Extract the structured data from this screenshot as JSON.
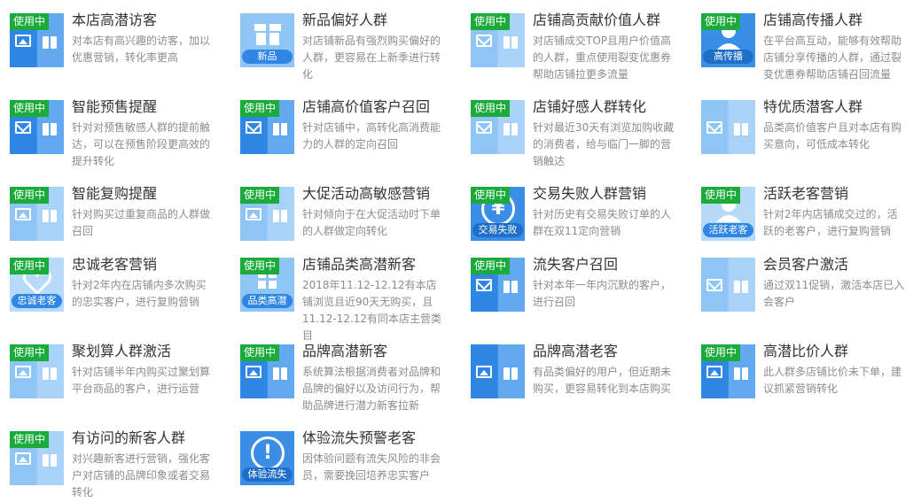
{
  "badge_text": "使用中",
  "cards": [
    {
      "title": "本店高潜访客",
      "desc": "对本店有高兴趣的访客，加以优惠营销，转化率更高"
    },
    {
      "title": "新品偏好人群",
      "desc": "对店铺新品有强烈购买偏好的人群，更容易在上新季进行转化",
      "icon_label": "新品"
    },
    {
      "title": "店铺高贡献价值人群",
      "desc": "对店铺成交TOP且用户价值高的人群，重点使用裂变优惠券帮助店铺拉更多流量"
    },
    {
      "title": "店铺高传播人群",
      "desc": "在平台高互动，能够有效帮助店铺分享传播的人群，通过裂变优惠券帮助店铺召回流量",
      "icon_label": "高传播"
    },
    {
      "title": "智能预售提醒",
      "desc": "针对对预售敏感人群的提前触达，可以在预售阶段更高效的提升转化"
    },
    {
      "title": "店铺高价值客户召回",
      "desc": "针对店铺中，高转化高消费能力的人群的定向召回"
    },
    {
      "title": "店铺好感人群转化",
      "desc": "针对最近30天有浏览加购收藏的消费者，给与临门一脚的营销触达"
    },
    {
      "title": "特优质潜客人群",
      "desc": "品类高价值客户且对本店有购买意向，可低成本转化"
    },
    {
      "title": "智能复购提醒",
      "desc": "针对购买过重复商品的人群做召回"
    },
    {
      "title": "大促活动高敏感营销",
      "desc": "针对倾向于在大促活动时下单的人群做定向转化"
    },
    {
      "title": "交易失败人群营销",
      "desc": "针对历史有交易失败订单的人群在双11定向营销",
      "icon_label": "交易失败",
      "icon_symbol": "¥"
    },
    {
      "title": "活跃老客营销",
      "desc": "针对2年内店铺成交过的，活跃的老客户，进行复购营销",
      "icon_label": "活跃老客"
    },
    {
      "title": "忠诚老客营销",
      "desc": "针对2年内在店铺内多次购买的忠实客户，进行复购营销",
      "icon_label": "忠诚老客"
    },
    {
      "title": "店铺品类高潜新客",
      "desc": "2018年11.12-12.12有本店铺浏览且近90天无购买，且11.12-12.12有同本店主营类目",
      "icon_label": "品类高潜"
    },
    {
      "title": "流失客户召回",
      "desc": "针对本年一年内沉默的客户，进行召回"
    },
    {
      "title": "会员客户激活",
      "desc": "通过双11促销，激活本店已入会客户"
    },
    {
      "title": "聚划算人群激活",
      "desc": "针对店铺半年内购买过聚划算平台商品的客户，进行运营"
    },
    {
      "title": "品牌高潜新客",
      "desc": "系统算法根据消费者对品牌和品牌的偏好以及访问行为，帮助品牌进行潜力新客拉新"
    },
    {
      "title": "品牌高潜老客",
      "desc": "有品类偏好的用户，但近期未购买，更容易转化到本店购买"
    },
    {
      "title": "高潜比价人群",
      "desc": "此人群多店铺比价未下单，建议抓紧营销转化"
    },
    {
      "title": "有访问的新客人群",
      "desc": "对兴趣新客进行营销，强化客户对店铺的品牌印象或者交易转化"
    },
    {
      "title": "体验流失预警老客",
      "desc": "因体验问题有流失风险的非会员，需要挽回培养忠实客户",
      "icon_label": "体验流失",
      "icon_symbol": "!"
    }
  ]
}
